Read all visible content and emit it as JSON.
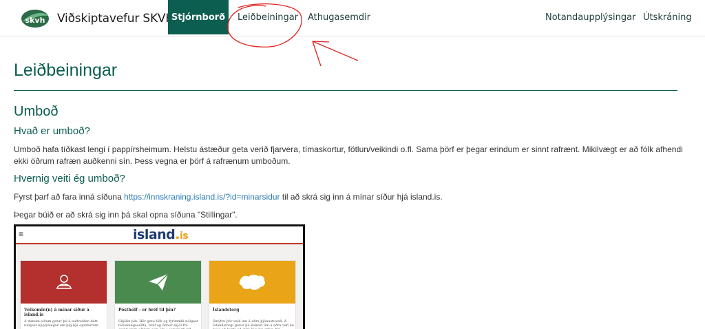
{
  "navbar": {
    "brand": "Viðskiptavefur SKVH",
    "logo_text": "skvh",
    "items": [
      {
        "label": "Stjórnborð",
        "active": true
      },
      {
        "label": "Leiðbeiningar",
        "active": false
      },
      {
        "label": "Athugasemdir",
        "active": false
      }
    ],
    "right_items": [
      {
        "label": "Notandaupplýsingar"
      },
      {
        "label": "Útskráning"
      }
    ]
  },
  "content": {
    "title": "Leiðbeiningar",
    "section_heading": "Umboð",
    "q1_heading": "Hvað er umboð?",
    "q1_text": "Umboð hafa tíðkast lengi í pappírsheimum. Helstu ástæður geta verið fjarvera, tímaskortur, fötlun/veikindi o.fl. Sama þörf er þegar erindum er sinnt rafrænt. Mikilvægt er að fólk afhendi ekki öðrum rafræn auðkenni sín. Þess vegna er þörf á rafrænum umboðum.",
    "q2_heading": "Hvernig veiti ég umboð?",
    "q2_text_before": "Fyrst þarf að fara inná síðuna ",
    "q2_link": "https://innskraning.island.is/?id=minarsidur",
    "q2_text_after": " til að skrá sig inn á mínar síður hjá island.is.",
    "q2_text2": "Þegar búið er að skrá sig inn þá skal opna síðuna \"Stillingar\"."
  },
  "embedded_screenshot": {
    "menu_glyph": "≡",
    "logo_main": "island",
    "logo_dot": ".",
    "logo_is": "is",
    "cards": [
      {
        "title": "Velkomin(n) á mínar síður á island.is",
        "text": "Á mínum síðum getur þú á auðveldan hátt nálgast upplýsingar um þig hjá opinberum",
        "color": "#b3302e",
        "icon": "people-icon"
      },
      {
        "title": "Pósthólf - er bréf til þín?",
        "text": "Skjölin þín. Hér geta fólk og fyrirtæki nálgast tölvuinngasellta, bréf og önnur skjöl frá opinberum aðilum sem eru í samstarfi við",
        "color": "#4a8a4f",
        "icon": "paper-plane-icon"
      },
      {
        "title": "Íslandstorg",
        "text": "Smýttu þér veld inn á aðra þjónustuvefi. Á Íslandstorgi getur þú komist inn á aðra vefi án þess að þurfa að skrá þig inn aftur. Þín",
        "color": "#e9a417",
        "icon": "iceland-map-icon"
      }
    ]
  },
  "colors": {
    "brand_green": "#0b5e50",
    "link_blue": "#2a7bb5",
    "annotation_red": "#e0201b"
  }
}
